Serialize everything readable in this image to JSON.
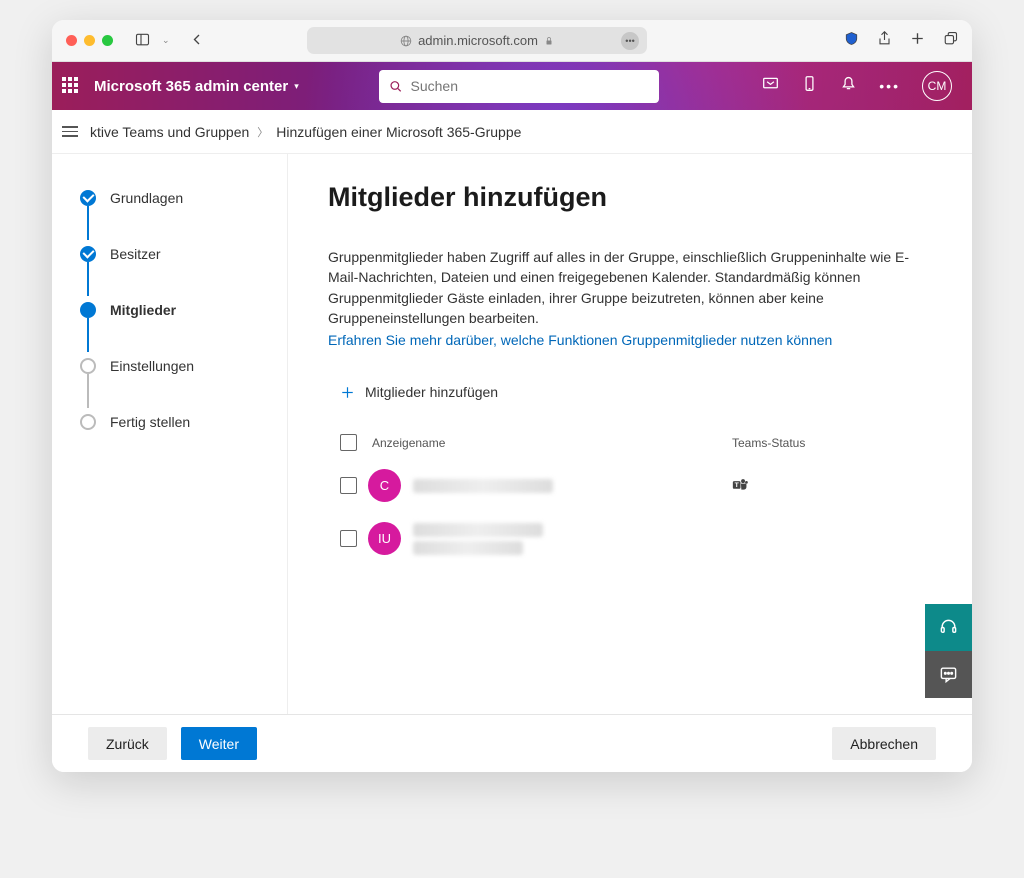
{
  "browser": {
    "url": "admin.microsoft.com"
  },
  "header": {
    "title": "Microsoft 365 admin center",
    "search_placeholder": "Suchen",
    "avatar": "CM"
  },
  "breadcrumb": {
    "root": "ktive Teams und Gruppen",
    "current": "Hinzufügen einer Microsoft 365-Gruppe"
  },
  "steps": [
    {
      "label": "Grundlagen",
      "state": "done"
    },
    {
      "label": "Besitzer",
      "state": "done"
    },
    {
      "label": "Mitglieder",
      "state": "current"
    },
    {
      "label": "Einstellungen",
      "state": "upcoming"
    },
    {
      "label": "Fertig stellen",
      "state": "upcoming"
    }
  ],
  "page": {
    "heading": "Mitglieder hinzufügen",
    "description": "Gruppenmitglieder haben Zugriff auf alles in der Gruppe, einschließlich Gruppeninhalte wie E-Mail-Nachrichten, Dateien und einen freigegebenen Kalender. Standardmäßig können Gruppenmitglieder Gäste einladen, ihrer Gruppe beizutreten, können aber keine Gruppeneinstellungen bearbeiten.",
    "learn_more": "Erfahren Sie mehr darüber, welche Funktionen Gruppenmitglieder nutzen können",
    "add_button": "Mitglieder hinzufügen"
  },
  "table": {
    "col_name": "Anzeigename",
    "col_status": "Teams-Status",
    "rows": [
      {
        "avatar": "C",
        "color": "#d61a9e",
        "has_teams": true
      },
      {
        "avatar": "IU",
        "color": "#d61a9e",
        "has_teams": false
      }
    ]
  },
  "footer": {
    "back": "Zurück",
    "next": "Weiter",
    "cancel": "Abbrechen"
  }
}
